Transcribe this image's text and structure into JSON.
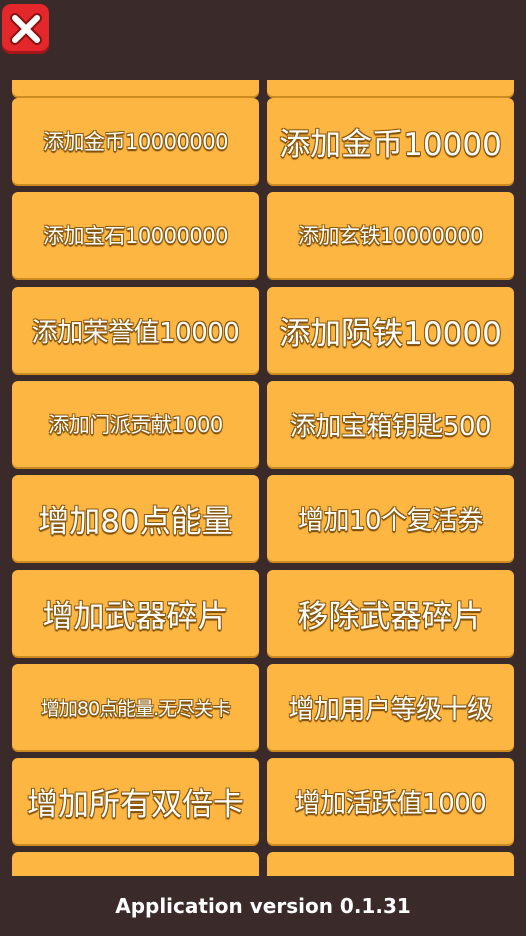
{
  "close_icon": "close-x-icon",
  "colors": {
    "background": "#3a2a2a",
    "tile": "#fdb642",
    "close": "#e3272a"
  },
  "buttons": [
    {
      "left": "添加金币10000000",
      "right": "添加金币10000"
    },
    {
      "left": "添加宝石10000000",
      "right": "添加玄铁10000000"
    },
    {
      "left": "添加荣誉值10000",
      "right": "添加陨铁10000"
    },
    {
      "left": "添加门派贡献1000",
      "right": "添加宝箱钥匙500"
    },
    {
      "left": "增加80点能量",
      "right": "增加10个复活券"
    },
    {
      "left": "增加武器碎片",
      "right": "移除武器碎片"
    },
    {
      "left": "增加80点能量.无尽关卡",
      "right": "增加用户等级十级"
    },
    {
      "left": "增加所有双倍卡",
      "right": "增加活跃值1000"
    }
  ],
  "footer": {
    "version": "Application version 0.1.31"
  }
}
